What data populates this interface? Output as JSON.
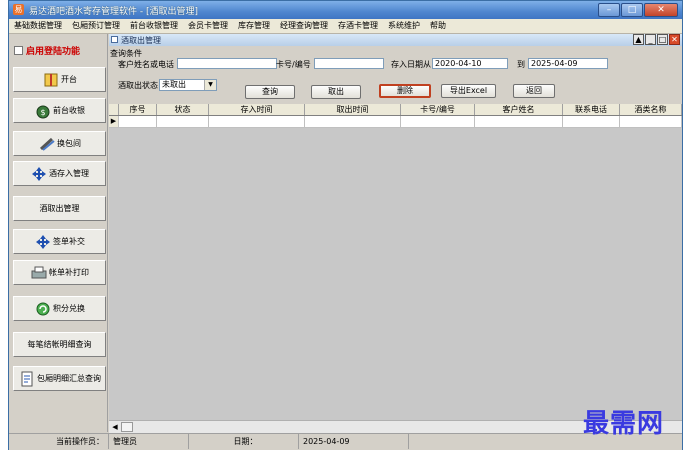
{
  "window": {
    "title": "易达酒吧酒水寄存管理软件 - [酒取出管理]",
    "app_icon": "易",
    "buttons": {
      "minimize": "–",
      "maximize": "□",
      "close": "✕"
    }
  },
  "menu": [
    "基础数据管理",
    "包厢预订管理",
    "前台收银管理",
    "会员卡管理",
    "库存管理",
    "经理查询管理",
    "存酒卡管理",
    "系统维护",
    "帮助"
  ],
  "sidebar": {
    "login_toggle": "启用登陆功能",
    "buttons": [
      {
        "label": "开台",
        "icon": "open-table-icon"
      },
      {
        "label": "前台收银",
        "icon": "money-bag-icon"
      },
      {
        "label": "换包间",
        "icon": "pencil-icon"
      },
      {
        "label": "酒存入管理",
        "icon": "move-arrows-icon"
      },
      {
        "label": "酒取出管理",
        "icon": ""
      },
      {
        "label": "签单补交",
        "icon": "move-arrows-icon"
      },
      {
        "label": "帐单补打印",
        "icon": "printer-icon"
      },
      {
        "label": "积分兑换",
        "icon": "refresh-icon"
      },
      {
        "label": "每笔结帐明细查询",
        "icon": ""
      },
      {
        "label": "包厢明细汇总查询",
        "icon": "document-icon"
      }
    ]
  },
  "child_window": {
    "title": "酒取出管理",
    "buttons": {
      "restore": "▲",
      "minimize": "_",
      "maximize": "□",
      "close": "✕"
    }
  },
  "query": {
    "section_label": "查询条件",
    "customer_label": "客户姓名或电话",
    "customer_value": "",
    "card_label": "卡号/编号",
    "card_value": "",
    "date_from_label": "存入日期从",
    "date_from": "2020-04-10",
    "date_to_label": "到",
    "date_to": "2025-04-09",
    "status_label": "酒取出状态",
    "status_value": "未取出",
    "buttons": {
      "search": "查询",
      "take_out": "取出",
      "delete": "删除",
      "export": "导出Excel",
      "back": "返回"
    }
  },
  "table": {
    "columns": [
      "序号",
      "状态",
      "存入时间",
      "取出时间",
      "卡号/编号",
      "客户姓名",
      "联系电话",
      "酒类名称"
    ],
    "row_indicator": "▶"
  },
  "statusbar": {
    "operator_label": "当前操作员：",
    "operator_value": "管理员",
    "date_label": "日期：",
    "date_value": "2025-04-09"
  },
  "watermark": "最需网"
}
